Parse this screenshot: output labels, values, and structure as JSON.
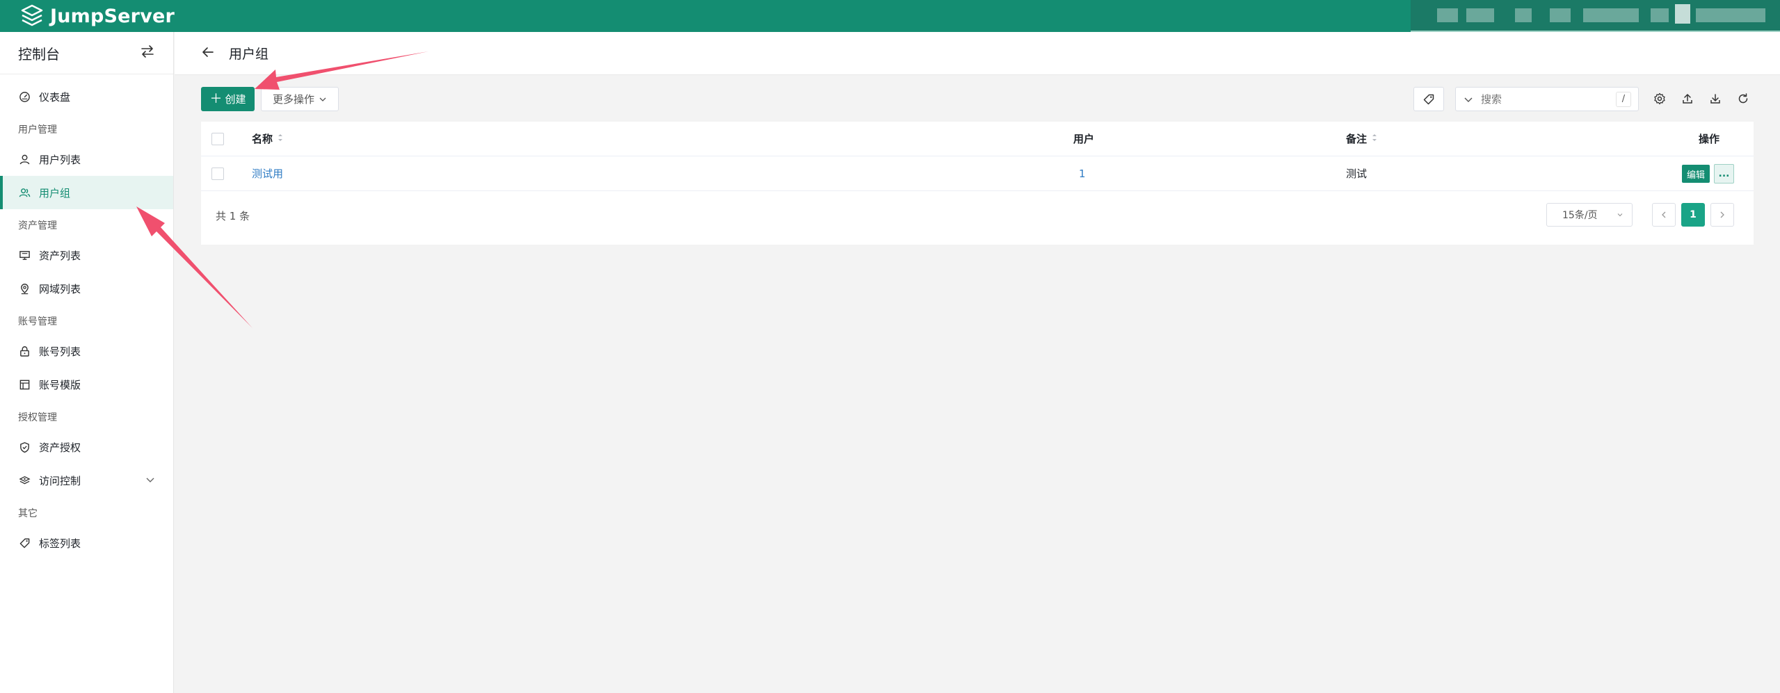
{
  "app": {
    "brand": "JumpServer"
  },
  "sidebar": {
    "title": "控制台",
    "items": [
      {
        "type": "item",
        "label": "仪表盘",
        "icon": "dashboard-icon"
      },
      {
        "type": "group",
        "label": "用户管理"
      },
      {
        "type": "item",
        "label": "用户列表",
        "icon": "user-icon"
      },
      {
        "type": "item",
        "label": "用户组",
        "icon": "user-group-icon",
        "active": true
      },
      {
        "type": "group",
        "label": "资产管理"
      },
      {
        "type": "item",
        "label": "资产列表",
        "icon": "monitor-icon"
      },
      {
        "type": "item",
        "label": "网域列表",
        "icon": "location-icon"
      },
      {
        "type": "group",
        "label": "账号管理"
      },
      {
        "type": "item",
        "label": "账号列表",
        "icon": "lock-icon"
      },
      {
        "type": "item",
        "label": "账号模版",
        "icon": "template-icon"
      },
      {
        "type": "group",
        "label": "授权管理"
      },
      {
        "type": "item",
        "label": "资产授权",
        "icon": "shield-icon"
      },
      {
        "type": "item",
        "label": "访问控制",
        "icon": "layers-icon",
        "expandable": true
      },
      {
        "type": "group",
        "label": "其它"
      },
      {
        "type": "item",
        "label": "标签列表",
        "icon": "tag-icon"
      }
    ]
  },
  "page": {
    "title": "用户组"
  },
  "toolbar": {
    "create_label": "创建",
    "more_label": "更多操作",
    "search_placeholder": "搜索",
    "search_shortcut": "/"
  },
  "table": {
    "columns": {
      "name": "名称",
      "users": "用户",
      "comment": "备注",
      "actions": "操作"
    },
    "rows": [
      {
        "name": "测试用",
        "users": "1",
        "comment": "测试",
        "edit_label": "编辑",
        "more_label": "..."
      }
    ]
  },
  "pagination": {
    "total_text": "共 1 条",
    "page_size": "15条/页",
    "current_page": "1"
  },
  "colors": {
    "brand": "#148d72",
    "annotation": "#f0506e"
  }
}
